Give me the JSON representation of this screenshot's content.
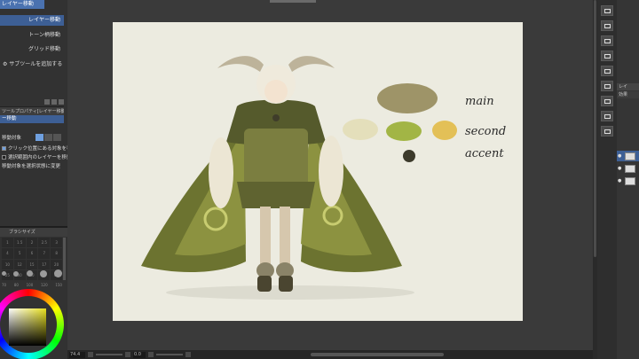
{
  "left_panel": {
    "sub_tool_tab": "レイヤー移動",
    "tools": [
      {
        "label": "レイヤー移動",
        "selected": true
      },
      {
        "label": "トーン柄移動",
        "selected": false
      },
      {
        "label": "グリッド移動",
        "selected": false
      }
    ],
    "add_subtool": "サブツールを追加する",
    "tool_property_header": "ツールプロパティ[レイヤー移動]",
    "tool_property_title": "ー移動",
    "property_rows": [
      {
        "label": "移動対象",
        "checked": false,
        "type": "segment"
      },
      {
        "label": "クリック位置にある対象を移動",
        "checked": true,
        "type": "check"
      },
      {
        "label": "選択範囲内のレイヤーを移動",
        "checked": false,
        "type": "check"
      },
      {
        "label": "移動対象を選択状態に変更",
        "checked": false,
        "type": "text"
      }
    ],
    "brush_size_header": "ブラシサイズ",
    "brush_sizes": [
      "1",
      "1.5",
      "2",
      "2.5",
      "3",
      "4",
      "5",
      "6",
      "7",
      "8",
      "10",
      "12",
      "15",
      "17",
      "20",
      "25",
      "30",
      "40",
      "50",
      "60"
    ],
    "size_values": [
      "70",
      "80",
      "100",
      "120",
      "150"
    ]
  },
  "canvas": {
    "palette_labels": {
      "main": "main",
      "second": "second",
      "accent": "accent"
    },
    "colors": {
      "main": "#9e9468",
      "second_1": "#e4dfbb",
      "second_2": "#a2b545",
      "second_3": "#e3c057",
      "accent": "#3c3a2b",
      "background": "#ecebe0"
    }
  },
  "status": {
    "zoom": "74.4",
    "rotation": "0.0"
  },
  "layer_panel": {
    "tab": "レイ",
    "tab2": "効果"
  }
}
